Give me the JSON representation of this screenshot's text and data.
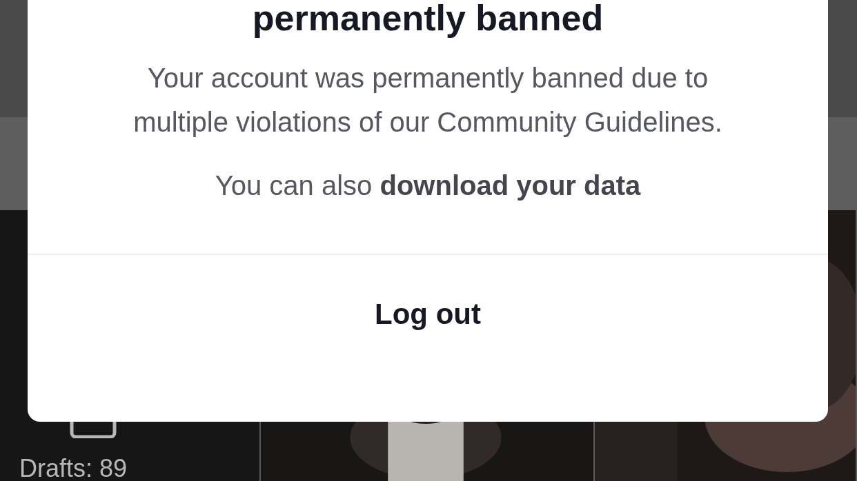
{
  "grid": {
    "drafts": {
      "label": "Drafts: 89"
    }
  },
  "dialog": {
    "title": "permanently banned",
    "message": "Your account was permanently banned due to multiple violations of our Community Guidelines.",
    "download_prefix": "You can also",
    "download_link": "download your data",
    "button": "Log out"
  }
}
